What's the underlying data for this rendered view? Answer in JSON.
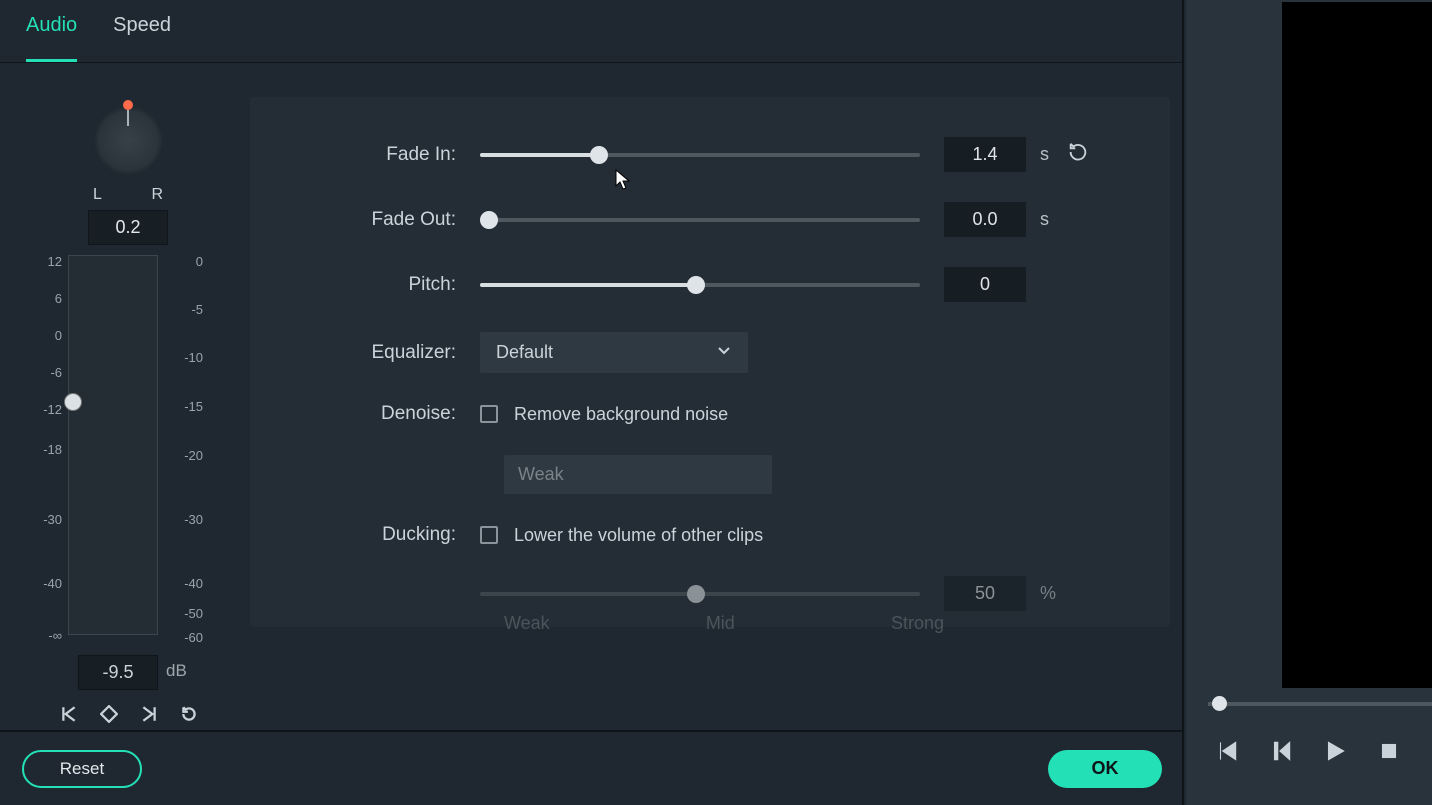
{
  "tabs": {
    "audio": "Audio",
    "speed": "Speed",
    "active": "audio"
  },
  "balance": {
    "L": "L",
    "R": "R",
    "value": "0.2"
  },
  "volume": {
    "db_value": "-9.5",
    "db_unit": "dB",
    "scale_left": [
      "12",
      "6",
      "0",
      "-6",
      "-12",
      "-18",
      "-30",
      "-40",
      "-∞"
    ],
    "scale_right": [
      "0",
      "-5",
      "-10",
      "-15",
      "-20",
      "-30",
      "-40",
      "-50",
      "-60"
    ]
  },
  "sliders": {
    "fade_in": {
      "label": "Fade In:",
      "value": "1.4",
      "unit": "s",
      "percent": 27
    },
    "fade_out": {
      "label": "Fade Out:",
      "value": "0.0",
      "unit": "s",
      "percent": 0
    },
    "pitch": {
      "label": "Pitch:",
      "value": "0",
      "percent": 49
    }
  },
  "equalizer": {
    "label": "Equalizer:",
    "selected": "Default"
  },
  "denoise": {
    "label": "Denoise:",
    "checkbox_label": "Remove background noise",
    "strength_label": "Weak"
  },
  "ducking": {
    "label": "Ducking:",
    "checkbox_label": "Lower the volume of other clips",
    "value": "50",
    "unit": "%",
    "percent": 49,
    "marks": {
      "weak": "Weak",
      "mid": "Mid",
      "strong": "Strong"
    }
  },
  "buttons": {
    "reset": "Reset",
    "ok": "OK"
  }
}
